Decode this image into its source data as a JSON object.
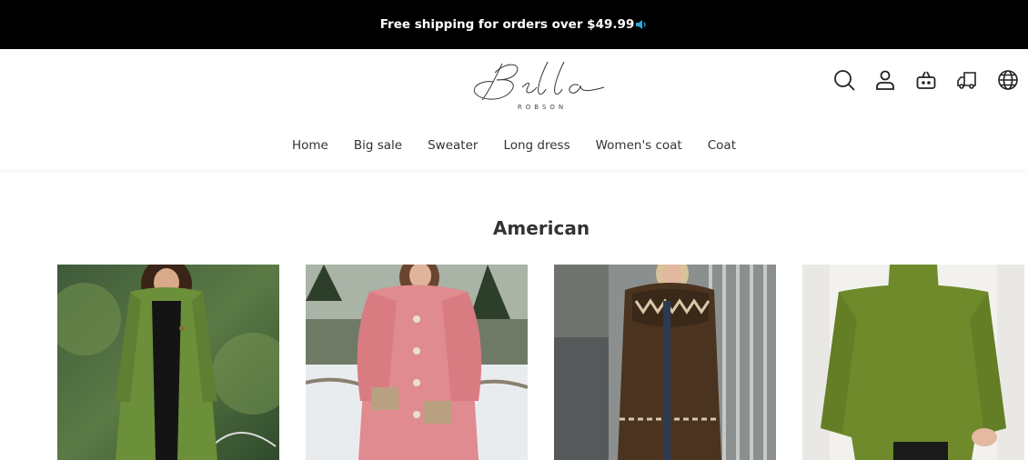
{
  "announcement": {
    "text": "Free shipping for orders over $49.99",
    "icon": "speaker-icon"
  },
  "brand": {
    "logo_script": "Bella",
    "logo_sub": "ROBSON"
  },
  "header_icons": [
    "search-icon",
    "account-icon",
    "cart-icon",
    "shipping-truck-icon",
    "globe-icon"
  ],
  "nav": {
    "items": [
      {
        "label": "Home"
      },
      {
        "label": "Big sale"
      },
      {
        "label": "Sweater"
      },
      {
        "label": "Long dress"
      },
      {
        "label": "Women's coat"
      },
      {
        "label": "Coat"
      }
    ]
  },
  "section": {
    "title": "American"
  },
  "products": [
    {
      "image": "green long knit cardigan"
    },
    {
      "image": "pink chunky knit cardigan"
    },
    {
      "image": "brown fair isle cardigan"
    },
    {
      "image": "olive green turtleneck sweater"
    }
  ],
  "colors": {
    "announcement_bg": "#000000",
    "speaker_accent": "#2aa6df"
  }
}
